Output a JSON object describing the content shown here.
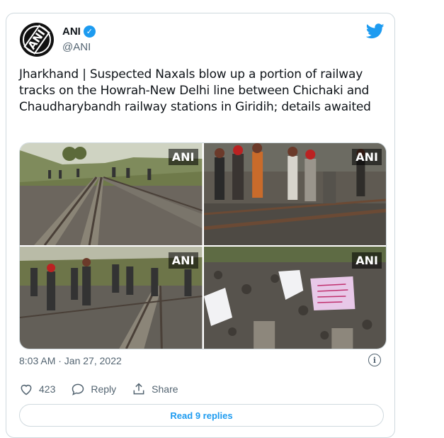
{
  "author": {
    "name": "ANI",
    "handle": "@ANI",
    "avatar_text": "ANI"
  },
  "tweet": {
    "text": "Jharkhand | Suspected Naxals blow up a portion of railway tracks on the Howrah-New Delhi line between Chichaki and Chaudharybandh railway stations in Giridih; details awaited"
  },
  "media": {
    "watermark": "ANI"
  },
  "meta": {
    "timestamp": "8:03 AM · Jan 27, 2022",
    "info_glyph": "i"
  },
  "actions": {
    "like_count": "423",
    "reply_label": "Reply",
    "share_label": "Share"
  },
  "replies": {
    "label": "Read 9 replies"
  },
  "colors": {
    "accent": "#1d9bf0",
    "secondary_text": "#536471",
    "border": "#cfd9de"
  }
}
